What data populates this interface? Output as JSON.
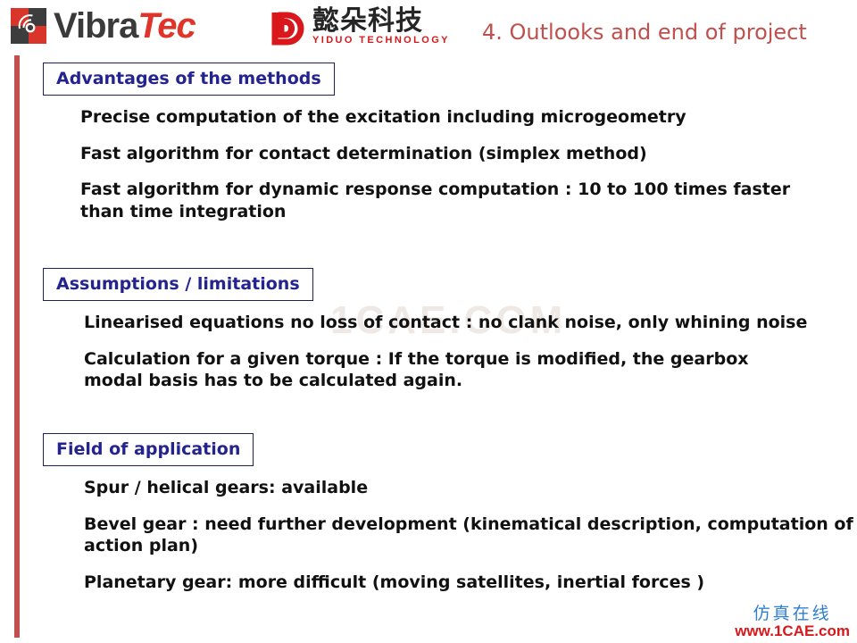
{
  "slide": {
    "title": "4. Outlooks and end of project",
    "accent_red": "#c0504d",
    "heading_blue": "#24248f",
    "background": "#ffffff"
  },
  "logos": {
    "vibratec": {
      "icon": "vibratec-waves-icon",
      "word_part1": "Vibra",
      "word_part2": "Tec",
      "color_part1": "#3a3a3a",
      "color_part2": "#e0342a"
    },
    "yiduo": {
      "icon": "yiduo-d-mark-icon",
      "chinese": "懿朵科技",
      "english": "YIDUO TECHNOLOGY",
      "color_chinese": "#262626",
      "color_english": "#d8181b"
    }
  },
  "sections": [
    {
      "heading": "Advantages of the methods",
      "bullets": [
        "Precise computation of the excitation including microgeometry",
        "Fast algorithm for contact determination  (simplex method)",
        "Fast algorithm for dynamic response computation : 10 to 100 times faster than time integration"
      ]
    },
    {
      "heading": "Assumptions / limitations",
      "bullets": [
        "Linearised equations no loss of contact  : no clank noise, only whining noise",
        "Calculation for a given torque : If the torque is modified, the gearbox modal basis has to be calculated again."
      ]
    },
    {
      "heading": "Field of application",
      "bullets": [
        "Spur / helical gears: available",
        "Bevel gear : need further development (kinematical description, computation of action plan)",
        "Planetary gear: more difficult (moving satellites, inertial forces )"
      ]
    }
  ],
  "watermarks": {
    "center": "1CAE.COM",
    "corner_cn": "仿真在线",
    "corner_url": "www.1CAE.com"
  }
}
